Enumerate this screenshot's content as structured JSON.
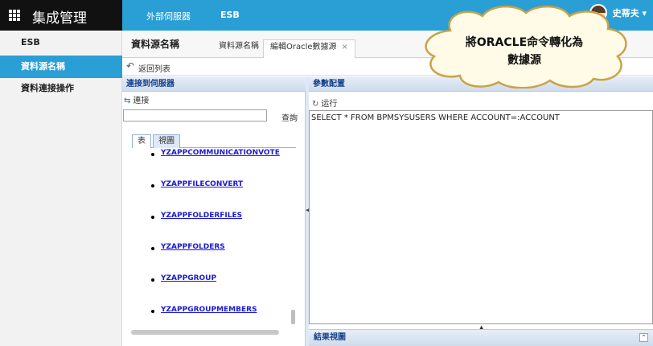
{
  "app": {
    "title": "集成管理"
  },
  "topnav": {
    "tab1": "外部伺服器",
    "tab2": "ESB",
    "user": "史蒂夫 ▾"
  },
  "sidebar": {
    "items": [
      {
        "label": "ESB"
      },
      {
        "label": "資料源名稱"
      },
      {
        "label": "資料連接操作"
      }
    ]
  },
  "page": {
    "title": "資料源名稱",
    "tabs": [
      {
        "label": "資料源名稱"
      },
      {
        "label": "編輯Oracle數據源",
        "close": "×"
      }
    ]
  },
  "back": {
    "label": "返回列表"
  },
  "left_panel": {
    "header": "連接到伺服器",
    "connect": "連接",
    "search_value": "",
    "search_button": "查詢",
    "tabs": [
      "表",
      "視圖"
    ],
    "tables": [
      "YZAPPCOMMUNICATIONVOTE",
      "YZAPPFILECONVERT",
      "YZAPPFOLDERFILES",
      "YZAPPFOLDERS",
      "YZAPPGROUP",
      "YZAPPGROUPMEMBERS"
    ]
  },
  "right_panel": {
    "header": "參數配置",
    "run": "运行",
    "sql": "SELECT * FROM BPMSYSUSERS WHERE ACCOUNT=:ACCOUNT",
    "result_header": "結果視圖"
  },
  "callout": {
    "line1": "將ORACLE命令轉化為",
    "line2": "數據源"
  },
  "colors": {
    "accent": "#2a9fd6",
    "brand_bg": "#111111",
    "link": "#1a1ad6",
    "panel_header": "#15428b"
  }
}
